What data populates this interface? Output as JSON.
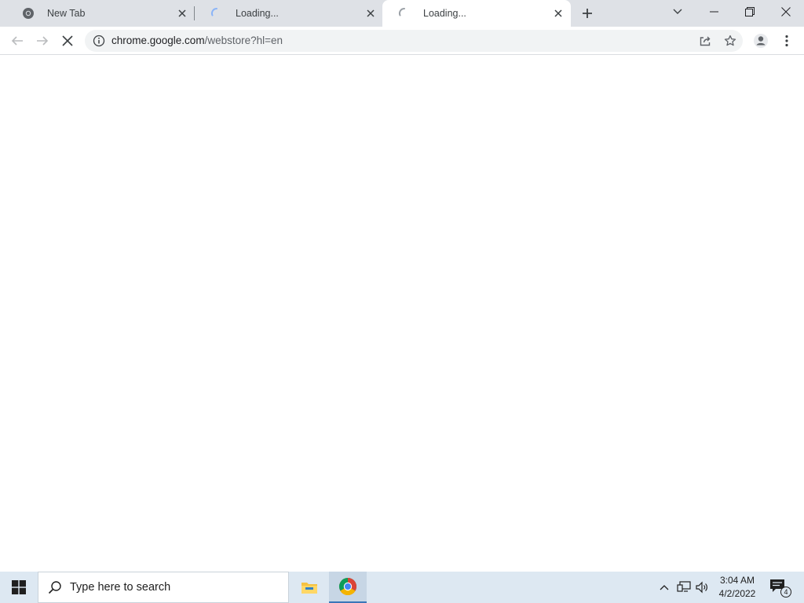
{
  "browser": {
    "tabs": [
      {
        "title": "New Tab",
        "favicon": "chrome-icon",
        "active": false
      },
      {
        "title": "Loading...",
        "favicon": "loading-spinner-icon",
        "active": false
      },
      {
        "title": "Loading...",
        "favicon": "loading-spinner-icon",
        "active": true
      }
    ],
    "omnibox": {
      "url_host": "chrome.google.com",
      "url_path": "/webstore?hl=en"
    }
  },
  "taskbar": {
    "search_placeholder": "Type here to search",
    "clock_time": "3:04 AM",
    "clock_date": "4/2/2022",
    "notification_count": "4"
  },
  "colors": {
    "tabstrip_bg": "#dee1e6",
    "taskbar_bg": "#dde8f2",
    "omnibox_bg": "#f1f3f4",
    "chrome_red": "#db4437",
    "chrome_yellow": "#f4b400",
    "chrome_green": "#0f9d58",
    "chrome_blue": "#4285f4"
  }
}
